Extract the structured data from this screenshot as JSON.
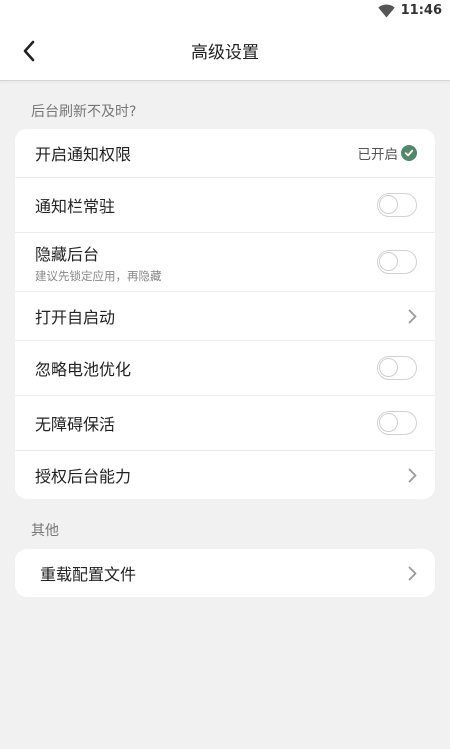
{
  "status_bar": {
    "time": "11:46",
    "wifi_icon": "wifi-icon"
  },
  "header": {
    "back_icon": "chevron-left-icon",
    "title": "高级设置"
  },
  "section_background": {
    "title": "后台刷新不及时?",
    "items": [
      {
        "label": "开启通知权限",
        "control": "status",
        "status_text": "已开启",
        "status_icon": "check-circle-icon",
        "status_color": "#4f8a68"
      },
      {
        "label": "通知栏常驻",
        "control": "toggle",
        "on": false
      },
      {
        "label": "隐藏后台",
        "sublabel": "建议先锁定应用，再隐藏",
        "control": "toggle",
        "on": false
      },
      {
        "label": "打开自启动",
        "control": "chevron"
      },
      {
        "label": "忽略电池优化",
        "control": "toggle",
        "on": false
      },
      {
        "label": "无障碍保活",
        "control": "toggle",
        "on": false
      },
      {
        "label": "授权后台能力",
        "control": "chevron"
      }
    ]
  },
  "section_other": {
    "title": "其他",
    "items": [
      {
        "label": "重载配置文件",
        "control": "chevron"
      }
    ]
  }
}
